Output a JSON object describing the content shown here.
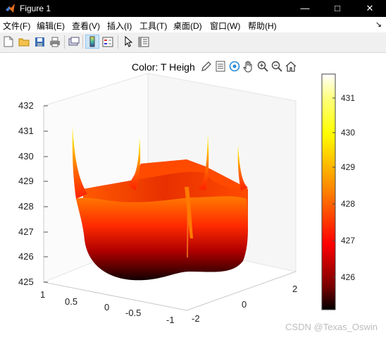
{
  "window": {
    "title": "Figure 1"
  },
  "menu": [
    "文件(F)",
    "编辑(E)",
    "查看(V)",
    "插入(I)",
    "工具(T)",
    "桌面(D)",
    "窗口(W)",
    "帮助(H)"
  ],
  "plot": {
    "title": "Color: T  Heigh",
    "z_ticks": [
      "432",
      "431",
      "430",
      "429",
      "428",
      "427",
      "426",
      "425"
    ],
    "x_ticks": [
      "1",
      "0.5",
      "0",
      "-0.5",
      "-1"
    ],
    "y_ticks": [
      "-2",
      "0",
      "2"
    ],
    "colorbar_ticks": [
      "431",
      "430",
      "429",
      "428",
      "427",
      "426"
    ]
  },
  "chart_data": {
    "type": "surface",
    "colormap": "hot",
    "z_range": [
      425,
      432
    ],
    "x_range": [
      -1,
      1
    ],
    "y_range": [
      -2,
      2
    ],
    "color_range": [
      425.1,
      431.6
    ]
  },
  "watermark": "CSDN @Texas_Oswin"
}
